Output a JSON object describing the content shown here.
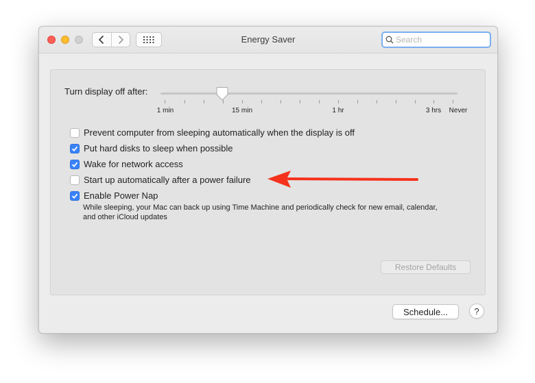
{
  "window": {
    "title": "Energy Saver",
    "search_placeholder": "Search"
  },
  "slider": {
    "label": "Turn display off after:",
    "tick_labels": [
      "1 min",
      "15 min",
      "1 hr",
      "3 hrs",
      "Never"
    ]
  },
  "options": [
    {
      "label": "Prevent computer from sleeping automatically when the display is off",
      "checked": false
    },
    {
      "label": "Put hard disks to sleep when possible",
      "checked": true
    },
    {
      "label": "Wake for network access",
      "checked": true
    },
    {
      "label": "Start up automatically after a power failure",
      "checked": false
    },
    {
      "label": "Enable Power Nap",
      "checked": true
    }
  ],
  "power_nap_description": "While sleeping, your Mac can back up using Time Machine and periodically check for new email, calendar, and other iCloud updates",
  "buttons": {
    "restore_defaults": "Restore Defaults",
    "schedule": "Schedule...",
    "help": "?"
  },
  "colors": {
    "accent": "#3a82f7",
    "annotation_arrow": "#f5321c"
  }
}
